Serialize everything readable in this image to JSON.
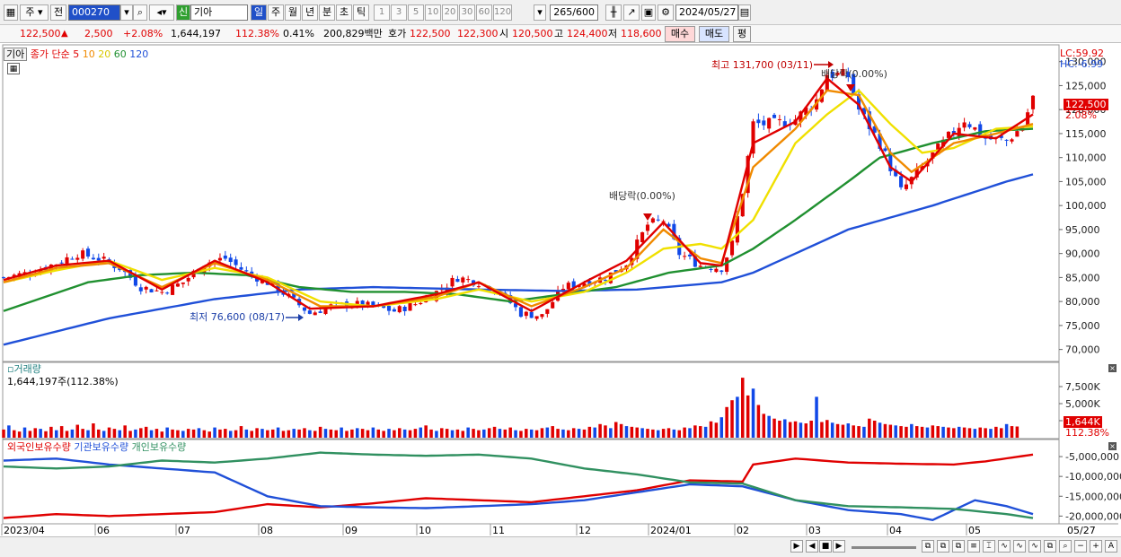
{
  "toolbar": {
    "period_mode": "주",
    "prev": "전",
    "code": "000270",
    "name": "기아",
    "new_badge": "신",
    "periods": [
      "일",
      "주",
      "월",
      "년",
      "분",
      "초",
      "틱"
    ],
    "ticks": [
      "1",
      "3",
      "5",
      "10",
      "20",
      "30",
      "60",
      "120"
    ],
    "count": "265/600",
    "date": "2024/05/27"
  },
  "quote": {
    "price": "122,500",
    "change": "2,500",
    "change_pct": "+2.08%",
    "volume": "1,644,197",
    "volume_ratio": "112.38%",
    "turnover_rate": "0.41%",
    "amount": "200,829백만",
    "ask_label": "호가",
    "ask": "122,500",
    "bid": "122,300",
    "open_label": "시",
    "open": "120,500",
    "high_label": "고",
    "high": "124,400",
    "low_label": "저",
    "low": "118,600",
    "buy_btn": "매수",
    "sell_btn": "매도",
    "eval_btn": "평"
  },
  "price_panel": {
    "stock": "기아",
    "legend_prefix": "종가 단순",
    "ma_periods": [
      "5",
      "10",
      "20",
      "60",
      "120"
    ],
    "lc": "LC:59.92",
    "hc": "HC:-6.99",
    "last_price": "122,500",
    "last_pct": "2.08%",
    "high_note": "최고 131,700 (03/11)",
    "low_note": "최저 76,600 (08/17)",
    "div1": "배당락(0.00%)",
    "div2": "배당락(0.00%)"
  },
  "volume_panel": {
    "title": "거래량",
    "value": "1,644,197주(112.38%)",
    "last": "1,644K",
    "last_pct": "112.38%"
  },
  "holding_panel": {
    "s1": "외국인보유수량",
    "s2": "기관보유수량",
    "s3": "개인보유수량"
  },
  "x_labels": [
    "2023/04",
    "06",
    "07",
    "08",
    "09",
    "10",
    "11",
    "12",
    "2024/01",
    "02",
    "03",
    "04",
    "05",
    "05/27"
  ],
  "colors": {
    "up": "#e00000",
    "down": "#1048e8",
    "ma5": "#e00000",
    "ma10": "#f08a00",
    "ma20": "#f0e000",
    "ma60": "#209030",
    "ma120": "#2050d8",
    "foreign": "#e00000",
    "inst": "#2050d8",
    "indiv": "#309060"
  },
  "chart_data": [
    {
      "type": "candlestick",
      "title": "",
      "y_ticks": [
        "70,000",
        "75,000",
        "80,000",
        "85,000",
        "90,000",
        "95,000",
        "100,000",
        "105,000",
        "110,000",
        "115,000",
        "120,000",
        "125,000",
        "130,000"
      ],
      "ylim": [
        67500,
        132000
      ],
      "close_points": [
        [
          0,
          85000
        ],
        [
          5,
          86000
        ],
        [
          10,
          88000
        ],
        [
          14,
          90000
        ],
        [
          18,
          89000
        ],
        [
          22,
          87000
        ],
        [
          26,
          83000
        ],
        [
          30,
          82000
        ],
        [
          34,
          84000
        ],
        [
          38,
          88000
        ],
        [
          42,
          89000
        ],
        [
          46,
          86000
        ],
        [
          50,
          84000
        ],
        [
          54,
          81000
        ],
        [
          58,
          77500
        ],
        [
          62,
          79000
        ],
        [
          66,
          79500
        ],
        [
          70,
          79000
        ],
        [
          74,
          78000
        ],
        [
          78,
          79500
        ],
        [
          82,
          82000
        ],
        [
          86,
          85000
        ],
        [
          90,
          84000
        ],
        [
          94,
          82000
        ],
        [
          98,
          77500
        ],
        [
          102,
          77000
        ],
        [
          106,
          83000
        ],
        [
          110,
          84000
        ],
        [
          114,
          85000
        ],
        [
          118,
          88000
        ],
        [
          122,
          96000
        ],
        [
          125,
          97000
        ],
        [
          128,
          90000
        ],
        [
          132,
          87500
        ],
        [
          136,
          87000
        ],
        [
          138,
          92000
        ],
        [
          140,
          103000
        ],
        [
          142,
          117000
        ],
        [
          146,
          117000
        ],
        [
          150,
          118000
        ],
        [
          154,
          122000
        ],
        [
          156,
          127500
        ],
        [
          160,
          127000
        ],
        [
          162,
          120000
        ],
        [
          166,
          113000
        ],
        [
          170,
          103000
        ],
        [
          174,
          108000
        ],
        [
          178,
          113000
        ],
        [
          182,
          118000
        ],
        [
          186,
          114000
        ],
        [
          190,
          113500
        ],
        [
          193,
          116500
        ],
        [
          195,
          122500
        ]
      ],
      "ma5": [
        [
          0,
          84500
        ],
        [
          10,
          87500
        ],
        [
          20,
          88500
        ],
        [
          30,
          82500
        ],
        [
          40,
          88500
        ],
        [
          50,
          84000
        ],
        [
          58,
          78500
        ],
        [
          70,
          79000
        ],
        [
          82,
          81500
        ],
        [
          90,
          84000
        ],
        [
          100,
          78000
        ],
        [
          110,
          84000
        ],
        [
          118,
          88500
        ],
        [
          125,
          96500
        ],
        [
          132,
          88000
        ],
        [
          136,
          87500
        ],
        [
          142,
          113000
        ],
        [
          150,
          117500
        ],
        [
          156,
          126500
        ],
        [
          162,
          121000
        ],
        [
          168,
          108000
        ],
        [
          172,
          105000
        ],
        [
          180,
          115000
        ],
        [
          188,
          114000
        ],
        [
          195,
          119000
        ]
      ],
      "ma10": [
        [
          0,
          84000
        ],
        [
          10,
          87000
        ],
        [
          20,
          88000
        ],
        [
          30,
          83000
        ],
        [
          40,
          88000
        ],
        [
          50,
          84500
        ],
        [
          60,
          79000
        ],
        [
          70,
          79000
        ],
        [
          82,
          81000
        ],
        [
          90,
          84000
        ],
        [
          100,
          79000
        ],
        [
          110,
          83000
        ],
        [
          118,
          87000
        ],
        [
          125,
          95000
        ],
        [
          132,
          89000
        ],
        [
          136,
          88000
        ],
        [
          142,
          108000
        ],
        [
          150,
          116000
        ],
        [
          156,
          124000
        ],
        [
          162,
          123000
        ],
        [
          168,
          111000
        ],
        [
          172,
          107000
        ],
        [
          180,
          113000
        ],
        [
          188,
          115000
        ],
        [
          195,
          117000
        ]
      ],
      "ma20": [
        [
          0,
          84000
        ],
        [
          10,
          86500
        ],
        [
          20,
          88500
        ],
        [
          30,
          84500
        ],
        [
          40,
          87000
        ],
        [
          50,
          85000
        ],
        [
          60,
          80000
        ],
        [
          70,
          79000
        ],
        [
          82,
          80500
        ],
        [
          90,
          82500
        ],
        [
          100,
          80000
        ],
        [
          110,
          82000
        ],
        [
          118,
          86000
        ],
        [
          125,
          91000
        ],
        [
          132,
          92000
        ],
        [
          136,
          91000
        ],
        [
          142,
          97000
        ],
        [
          150,
          113000
        ],
        [
          156,
          119000
        ],
        [
          162,
          124000
        ],
        [
          168,
          117000
        ],
        [
          174,
          111000
        ],
        [
          180,
          112000
        ],
        [
          188,
          116000
        ],
        [
          195,
          116500
        ]
      ],
      "ma60": [
        [
          0,
          78000
        ],
        [
          8,
          81000
        ],
        [
          16,
          84000
        ],
        [
          26,
          85500
        ],
        [
          36,
          86000
        ],
        [
          46,
          85500
        ],
        [
          56,
          83000
        ],
        [
          66,
          82000
        ],
        [
          76,
          82000
        ],
        [
          86,
          81500
        ],
        [
          96,
          80000
        ],
        [
          106,
          81500
        ],
        [
          116,
          83000
        ],
        [
          126,
          86000
        ],
        [
          136,
          87500
        ],
        [
          142,
          91000
        ],
        [
          150,
          97000
        ],
        [
          160,
          105000
        ],
        [
          166,
          110000
        ],
        [
          176,
          113000
        ],
        [
          186,
          115500
        ],
        [
          195,
          116000
        ]
      ],
      "ma120": [
        [
          0,
          71000
        ],
        [
          20,
          76500
        ],
        [
          40,
          80500
        ],
        [
          56,
          82500
        ],
        [
          70,
          83000
        ],
        [
          90,
          82500
        ],
        [
          106,
          82200
        ],
        [
          120,
          82500
        ],
        [
          136,
          84000
        ],
        [
          142,
          86000
        ],
        [
          160,
          95000
        ],
        [
          176,
          100000
        ],
        [
          190,
          105000
        ],
        [
          195,
          106500
        ]
      ]
    },
    {
      "type": "bar",
      "title": "거래량",
      "y_ticks": [
        "2,500K",
        "5,000K",
        "7,500K"
      ],
      "ylim": [
        0,
        10000
      ],
      "values": [
        1200,
        1800,
        1100,
        900,
        1500,
        1000,
        1400,
        1300,
        950,
        1600,
        1100,
        1700,
        1000,
        1200,
        1900,
        1300,
        1100,
        2100,
        1200,
        1000,
        1500,
        1300,
        1100,
        1800,
        1000,
        1200,
        1400,
        1600,
        1100,
        1300,
        900,
        1500,
        1200,
        1100,
        1000,
        1300,
        1200,
        1400,
        1100,
        900,
        1500,
        1200,
        1300,
        1000,
        1100,
        1700,
        1200,
        1000,
        1400,
        1300,
        1100,
        1200,
        1500,
        1000,
        1100,
        1300,
        1200,
        1400,
        1100,
        1000,
        1600,
        1300,
        1200,
        1100,
        1500,
        1000,
        1200,
        1400,
        1300,
        1100,
        1500,
        1200,
        1000,
        1300,
        1100,
        1400,
        1200,
        1100,
        1300,
        1500,
        1800,
        1200,
        1000,
        1400,
        1300,
        1100,
        1200,
        1000,
        1500,
        1300,
        1100,
        1200,
        1400,
        1600,
        1300,
        1200,
        1500,
        1100,
        1000,
        1300,
        1200,
        1100,
        1400,
        1500,
        1700,
        1300,
        1200,
        1100,
        1400,
        1300,
        1200,
        1600,
        1500,
        2000,
        1800,
        1400,
        2300,
        2000,
        1700,
        1600,
        1500,
        1400,
        1300,
        1200,
        1100,
        1300,
        1400,
        1200,
        1100,
        1500,
        1400,
        1800,
        1700,
        1600,
        2400,
        2200,
        3000,
        4500,
        5500,
        6000,
        8800,
        6200,
        7200,
        4800,
        3500,
        3200,
        2800,
        2500,
        2700,
        2300,
        2400,
        2200,
        2100,
        2500,
        6000,
        2300,
        2600,
        2200,
        2000,
        1900,
        2100,
        1800,
        1700,
        1600,
        2800,
        2500,
        2200,
        2000,
        1900,
        1800,
        1700,
        1600,
        2000,
        1700,
        1600,
        1500,
        1800,
        1700,
        1600,
        1500,
        1400,
        1600,
        1500,
        1400,
        1300,
        1500,
        1400,
        1300,
        1600,
        1400,
        2000,
        1700,
        1644
      ]
    },
    {
      "type": "line",
      "title": "",
      "y_ticks": [
        "-5,000,000",
        "-10,000,000",
        "-15,000,000",
        "-20,000,000"
      ],
      "ylim": [
        -21500000,
        -2500000
      ],
      "series": [
        {
          "name": "외국인보유수량",
          "points": [
            [
              0,
              -20500000
            ],
            [
              10,
              -19500000
            ],
            [
              20,
              -20000000
            ],
            [
              30,
              -19500000
            ],
            [
              40,
              -19000000
            ],
            [
              50,
              -17000000
            ],
            [
              60,
              -17800000
            ],
            [
              70,
              -16800000
            ],
            [
              80,
              -15500000
            ],
            [
              90,
              -16000000
            ],
            [
              100,
              -16500000
            ],
            [
              110,
              -15000000
            ],
            [
              120,
              -13500000
            ],
            [
              130,
              -11000000
            ],
            [
              140,
              -11300000
            ],
            [
              142,
              -7000000
            ],
            [
              150,
              -5500000
            ],
            [
              160,
              -6500000
            ],
            [
              170,
              -6800000
            ],
            [
              180,
              -7000000
            ],
            [
              186,
              -6200000
            ],
            [
              195,
              -4500000
            ]
          ]
        },
        {
          "name": "기관보유수량",
          "points": [
            [
              0,
              -6000000
            ],
            [
              10,
              -5500000
            ],
            [
              20,
              -7000000
            ],
            [
              30,
              -8000000
            ],
            [
              40,
              -9000000
            ],
            [
              50,
              -15000000
            ],
            [
              60,
              -17500000
            ],
            [
              70,
              -17800000
            ],
            [
              80,
              -18000000
            ],
            [
              90,
              -17500000
            ],
            [
              100,
              -17000000
            ],
            [
              110,
              -16000000
            ],
            [
              120,
              -14000000
            ],
            [
              130,
              -12000000
            ],
            [
              140,
              -12500000
            ],
            [
              150,
              -16000000
            ],
            [
              160,
              -18500000
            ],
            [
              170,
              -19500000
            ],
            [
              176,
              -21000000
            ],
            [
              184,
              -16000000
            ],
            [
              190,
              -17500000
            ],
            [
              195,
              -19500000
            ]
          ]
        },
        {
          "name": "개인보유수량",
          "points": [
            [
              0,
              -7500000
            ],
            [
              10,
              -8000000
            ],
            [
              20,
              -7500000
            ],
            [
              30,
              -6000000
            ],
            [
              40,
              -6500000
            ],
            [
              50,
              -5500000
            ],
            [
              60,
              -4000000
            ],
            [
              70,
              -4500000
            ],
            [
              80,
              -4800000
            ],
            [
              90,
              -4500000
            ],
            [
              100,
              -5500000
            ],
            [
              110,
              -8000000
            ],
            [
              120,
              -9500000
            ],
            [
              130,
              -11500000
            ],
            [
              140,
              -11800000
            ],
            [
              150,
              -16000000
            ],
            [
              160,
              -17500000
            ],
            [
              170,
              -17800000
            ],
            [
              180,
              -18200000
            ],
            [
              190,
              -19500000
            ],
            [
              195,
              -20500000
            ]
          ]
        }
      ]
    }
  ]
}
